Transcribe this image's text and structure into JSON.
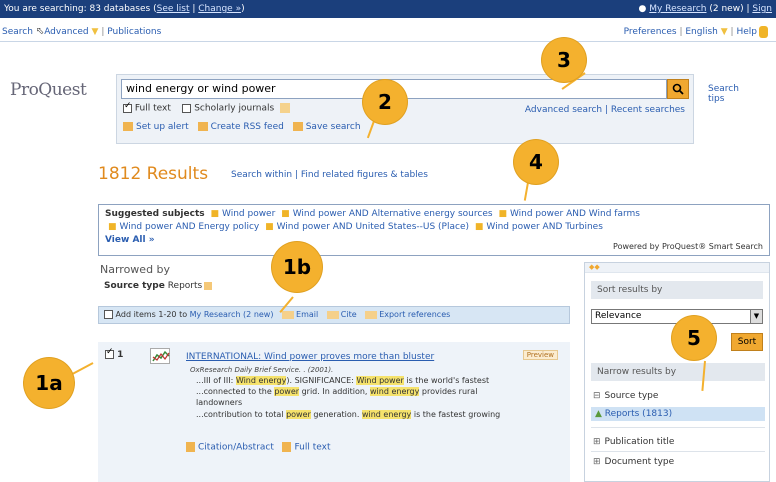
{
  "topbar": {
    "searching_text": "You are searching: 83 databases",
    "see_list": "See list",
    "change": "Change »",
    "my_research": "My Research",
    "my_research_count": "(2 new)",
    "sign": "Sign"
  },
  "nav": {
    "search": "Search",
    "advanced": "Advanced",
    "publications": "Publications",
    "preferences": "Preferences",
    "english": "English",
    "help": "Help"
  },
  "logo": "ProQuest",
  "search": {
    "query": "wind energy or wind power",
    "full_text": "Full text",
    "scholarly": "Scholarly journals",
    "advanced_search": "Advanced search",
    "recent_searches": "Recent searches",
    "set_up_alert": "Set up alert",
    "create_rss": "Create RSS feed",
    "save_search": "Save search",
    "tips": "Search tips"
  },
  "results": {
    "count": "1812 Results",
    "search_within": "Search within",
    "find_related": "Find related figures & tables"
  },
  "suggested": {
    "label": "Suggested subjects",
    "items": [
      "Wind power",
      "Wind power AND Alternative energy sources",
      "Wind power AND Wind farms",
      "Wind power AND Energy policy",
      "Wind power AND United States--US (Place)",
      "Wind power AND Turbines"
    ],
    "view_all": "View All »",
    "powered": "Powered by ProQuest® Smart Search"
  },
  "narrowed": {
    "title": "Narrowed by",
    "source_type_label": "Source type",
    "source_type_value": "Reports"
  },
  "actionbar": {
    "add_items": "Add items 1-20 to",
    "my_research": "My Research (2 new)",
    "email": "Email",
    "cite": "Cite",
    "export": "Export references"
  },
  "result1": {
    "number": "1",
    "title": "INTERNATIONAL: Wind power proves more than bluster",
    "preview": "Preview",
    "source": "OxResearch Daily Brief Service. . (2001).",
    "snippet1_pre": "...III of III: ",
    "snippet1_hl1": "Wind energy",
    "snippet1_mid": "). SIGNIFICANCE: ",
    "snippet1_hl2": "Wind power",
    "snippet1_post": " is the world's fastest",
    "snippet2_pre": "...connected to the ",
    "snippet2_hl1": "power",
    "snippet2_mid": " grid. In addition, ",
    "snippet2_hl2": "wind energy",
    "snippet2_post": " provides rural",
    "snippet3": "landowners",
    "snippet4_pre": "...contribution to total ",
    "snippet4_hl1": "power",
    "snippet4_mid": " generation. ",
    "snippet4_hl2": "wind energy",
    "snippet4_post": " is the fastest growing",
    "citation": "Citation/Abstract",
    "full_text": "Full text"
  },
  "sidebar": {
    "sort_by": "Sort results by",
    "sort_value": "Relevance",
    "sort_button": "Sort",
    "narrow_by": "Narrow results by",
    "facets": {
      "source_type": "Source type",
      "reports": "Reports (1813)",
      "publication_title": "Publication title",
      "document_type": "Document type"
    }
  },
  "callouts": {
    "c1a": "1a",
    "c1b": "1b",
    "c2": "2",
    "c3": "3",
    "c4": "4",
    "c5": "5"
  },
  "colors": {
    "accent": "#f4b12e",
    "brand_blue": "#1b3f7c",
    "link": "#2a5db0",
    "results_orange": "#e08a1e"
  }
}
